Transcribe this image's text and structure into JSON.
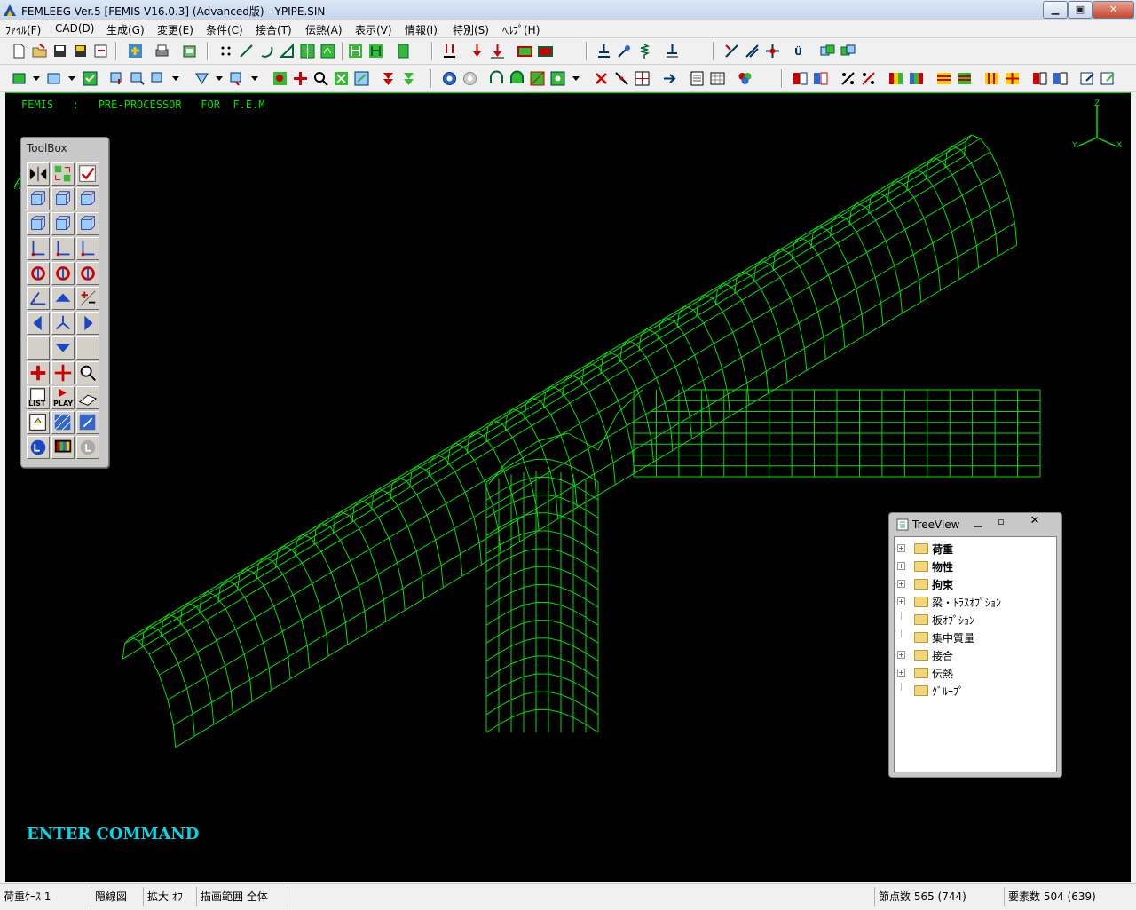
{
  "window": {
    "title": "FEMLEEG Ver.5 [FEMIS V16.0.3] (Advanced版) - YPIPE.SIN"
  },
  "menu": [
    "ﾌｧｲﾙ(F)",
    "CAD(D)",
    "生成(G)",
    "変更(E)",
    "条件(C)",
    "接合(T)",
    "伝熱(A)",
    "表示(V)",
    "情報(I)",
    "特別(S)",
    "ﾍﾙﾌﾟ(H)"
  ],
  "viewport": {
    "header": "FEMIS   :   PRE-PROCESSOR   FOR  F.E.M",
    "mesh_color": "#00e000",
    "axis_labels": {
      "z": "Z",
      "x": "X",
      "y": "Y"
    },
    "logo_text": "FEMIS"
  },
  "command": {
    "prompt": "ENTER COMMAND"
  },
  "toolbox": {
    "title": "ToolBox",
    "play_label": "PLAY",
    "list_label": "LIST"
  },
  "treeview": {
    "title": "TreeView",
    "items": [
      {
        "label": "荷重",
        "expandable": true,
        "bold": true
      },
      {
        "label": "物性",
        "expandable": true,
        "bold": true
      },
      {
        "label": "拘束",
        "expandable": true,
        "bold": true
      },
      {
        "label": "梁・ﾄﾗｽｵﾌﾟｼｮﾝ",
        "expandable": true,
        "bold": false
      },
      {
        "label": "板ｵﾌﾟｼｮﾝ",
        "expandable": false,
        "bold": false
      },
      {
        "label": "集中質量",
        "expandable": false,
        "bold": false
      },
      {
        "label": "接合",
        "expandable": true,
        "bold": false
      },
      {
        "label": "伝熱",
        "expandable": true,
        "bold": false
      },
      {
        "label": "ｸﾞﾙｰﾌﾟ",
        "expandable": false,
        "bold": false
      }
    ]
  },
  "status": {
    "load_case": "荷重ｹｰｽ 1",
    "hidden_line": "隠線図",
    "zoom": "拡大 ｵﾌ",
    "draw_range": "描画範囲 全体",
    "nodes": "節点数 565 (744)",
    "elements": "要素数 504 (639)"
  }
}
